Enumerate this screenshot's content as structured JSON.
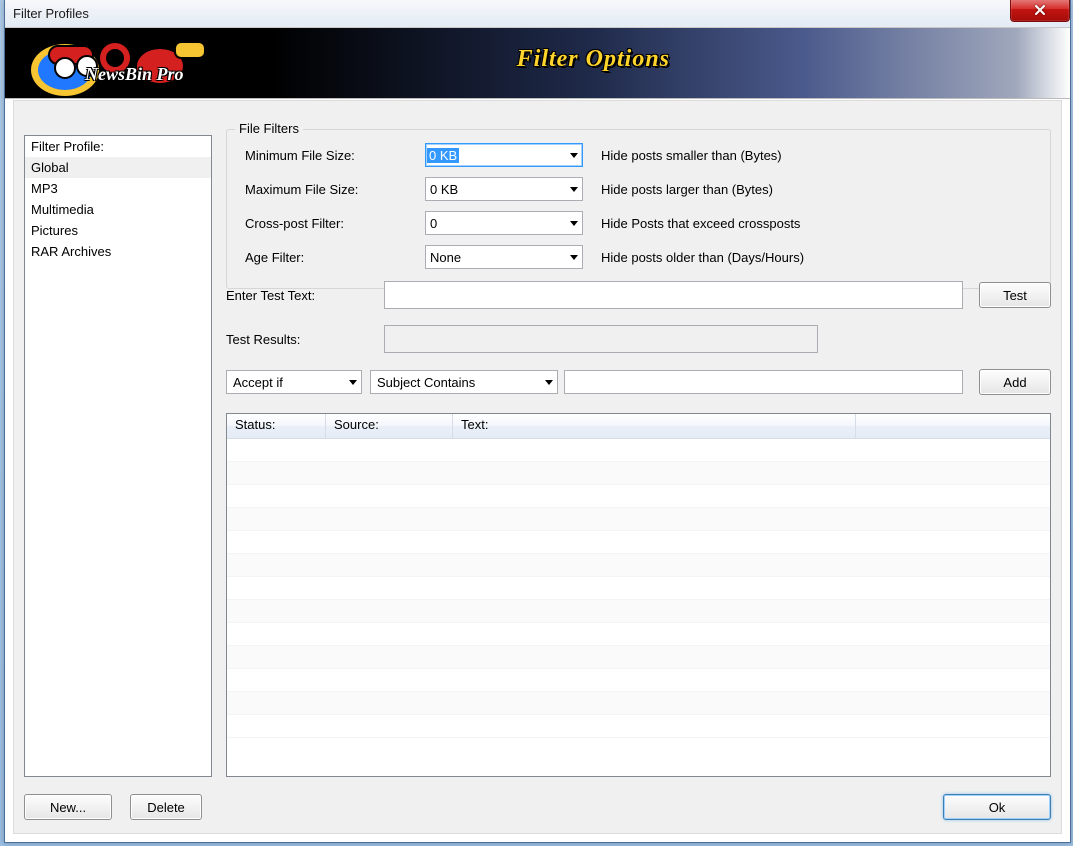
{
  "window": {
    "title": "Filter Profiles"
  },
  "banner": {
    "brand": "NewsBin Pro",
    "title": "Filter Options"
  },
  "sidebar": {
    "header": "Filter Profile:",
    "items": [
      "Global",
      "MP3",
      "Multimedia",
      "Pictures",
      "RAR Archives"
    ],
    "selected_index": 0
  },
  "file_filters": {
    "legend": "File Filters",
    "min_size": {
      "label": "Minimum File Size:",
      "value": "0 KB",
      "hint": "Hide posts smaller than (Bytes)"
    },
    "max_size": {
      "label": "Maximum File Size:",
      "value": "0 KB",
      "hint": "Hide posts larger than (Bytes)"
    },
    "crosspost": {
      "label": "Cross-post Filter:",
      "value": "0",
      "hint": "Hide Posts that exceed crossposts"
    },
    "age": {
      "label": "Age Filter:",
      "value": "None",
      "hint": "Hide posts older than (Days/Hours)"
    }
  },
  "test": {
    "enter_label": "Enter Test Text:",
    "enter_value": "",
    "results_label": "Test Results:",
    "results_value": "",
    "test_btn": "Test"
  },
  "rule": {
    "condition": "Accept if",
    "field": "Subject Contains",
    "value": "",
    "add_btn": "Add"
  },
  "table": {
    "columns": [
      "Status:",
      "Source:",
      "Text:",
      ""
    ]
  },
  "footer": {
    "new_btn": "New...",
    "delete_btn": "Delete",
    "ok_btn": "Ok"
  }
}
